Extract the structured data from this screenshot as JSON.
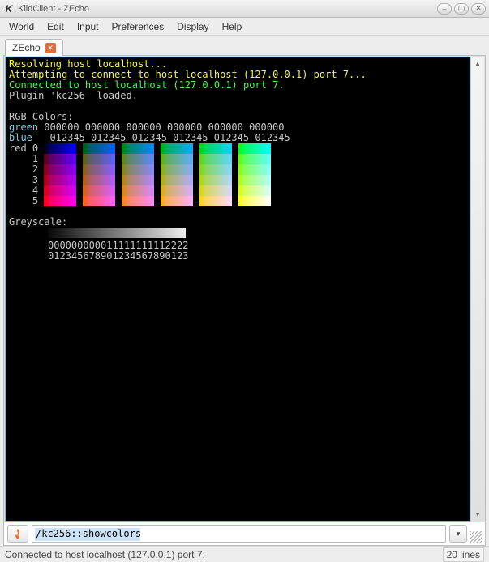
{
  "window": {
    "title": "KildClient - ZEcho"
  },
  "menu": {
    "world": "World",
    "edit": "Edit",
    "input": "Input",
    "preferences": "Preferences",
    "display": "Display",
    "help": "Help"
  },
  "tab": {
    "label": "ZEcho"
  },
  "terminal": {
    "l1": "Resolving host localhost...",
    "l2": "Attempting to connect to host localhost (127.0.0.1) port 7...",
    "l3": "Connected to host localhost (127.0.0.1) port 7.",
    "l4": "Plugin 'kc256' loaded.",
    "rgb_title": "RGB Colors:",
    "hdr_green": "green",
    "hdr_green_nums": "000000 000000 000000 000000 000000 000000",
    "hdr_blue": "blue",
    "hdr_blue_nums": "012345 012345 012345 012345 012345 012345",
    "red_lbl": "red",
    "red": [
      "0",
      "1",
      "2",
      "3",
      "4",
      "5"
    ],
    "grey_title": "Greyscale:",
    "grey_nums1": "000000000011111111112222",
    "grey_nums2": "012345678901234567890123"
  },
  "input": {
    "value": "/kc256::showcolors"
  },
  "status": {
    "left": "Connected to host localhost (127.0.0.1) port 7.",
    "right": "20 lines"
  },
  "chart_data": {
    "type": "heatmap",
    "title": "RGB Colors",
    "note": "6x6x6 xterm-256 RGB color cube, displayed as 6 blocks (green=0..5), each block 6 cols (blue=0..5) × 6 rows (red=0..5). Plus 24-step greyscale ramp.",
    "rgb_cube": {
      "red_levels": [
        0,
        1,
        2,
        3,
        4,
        5
      ],
      "green_levels": [
        0,
        1,
        2,
        3,
        4,
        5
      ],
      "blue_levels": [
        0,
        1,
        2,
        3,
        4,
        5
      ]
    },
    "greyscale_steps": 24
  }
}
